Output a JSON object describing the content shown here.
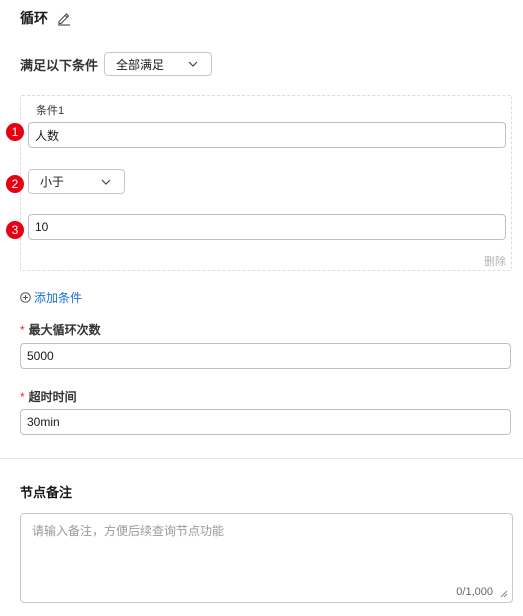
{
  "node": {
    "title": "循环",
    "edit_icon": "pencil-icon"
  },
  "match": {
    "label": "满足以下条件",
    "selected": "全部满足"
  },
  "condition": {
    "title": "条件1",
    "steps": [
      "1",
      "2",
      "3"
    ],
    "field_value": "人数",
    "operator_selected": "小于",
    "compare_value": "10",
    "delete_label": "删除"
  },
  "add_condition": {
    "label": "添加条件",
    "icon": "plus-circle-icon",
    "color": "#1a6ed8"
  },
  "max_loops": {
    "required_mark": "*",
    "label": "最大循环次数",
    "value": "5000"
  },
  "timeout": {
    "required_mark": "*",
    "label": "超时时间",
    "value": "30min"
  },
  "notes": {
    "title": "节点备注",
    "placeholder": "请输入备注，方便后续查询节点功能",
    "counter": "0/1,000"
  },
  "colors": {
    "badge": "#e60012",
    "required": "#e5322e",
    "link": "#1a6ed8"
  }
}
